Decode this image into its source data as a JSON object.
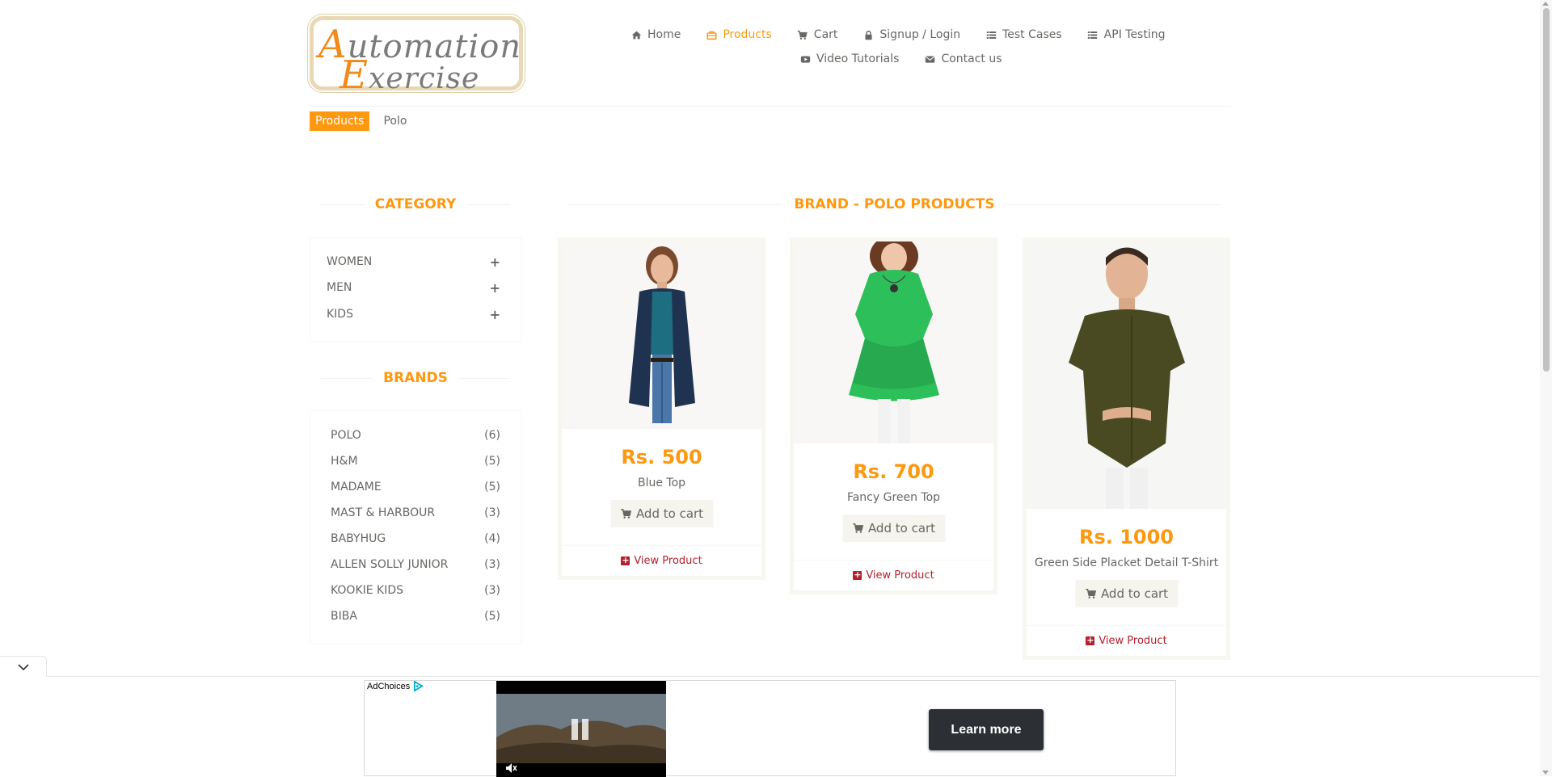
{
  "logo": {
    "line1_cap": "A",
    "line1_rest": "utomation",
    "line2_cap": "E",
    "line2_rest": "xercise"
  },
  "nav": {
    "row1": [
      {
        "label": "Home",
        "icon": "home-icon",
        "active": false
      },
      {
        "label": "Products",
        "icon": "shopping-bag-icon",
        "active": true
      },
      {
        "label": "Cart",
        "icon": "cart-icon",
        "active": false
      },
      {
        "label": "Signup / Login",
        "icon": "lock-icon",
        "active": false
      },
      {
        "label": "Test Cases",
        "icon": "list-icon",
        "active": false
      },
      {
        "label": "API Testing",
        "icon": "list-icon",
        "active": false
      }
    ],
    "row2": [
      {
        "label": "Video Tutorials",
        "icon": "youtube-icon",
        "active": false
      },
      {
        "label": "Contact us",
        "icon": "envelope-icon",
        "active": false
      }
    ]
  },
  "breadcrumb": {
    "section": "Products",
    "current": "Polo"
  },
  "sidebar": {
    "category_title": "Category",
    "categories": [
      {
        "label": "WOMEN"
      },
      {
        "label": "MEN"
      },
      {
        "label": "KIDS"
      }
    ],
    "brands_title": "Brands",
    "brands": [
      {
        "label": "POLO",
        "count": "(6)"
      },
      {
        "label": "H&M",
        "count": "(5)"
      },
      {
        "label": "MADAME",
        "count": "(5)"
      },
      {
        "label": "MAST & HARBOUR",
        "count": "(3)"
      },
      {
        "label": "BABYHUG",
        "count": "(4)"
      },
      {
        "label": "ALLEN SOLLY JUNIOR",
        "count": "(3)"
      },
      {
        "label": "KOOKIE KIDS",
        "count": "(3)"
      },
      {
        "label": "BIBA",
        "count": "(5)"
      }
    ]
  },
  "main": {
    "title": "Brand - Polo Products",
    "products": [
      {
        "price": "Rs. 500",
        "name": "Blue Top",
        "add_label": "Add to cart",
        "view_label": "View Product"
      },
      {
        "price": "Rs. 700",
        "name": "Fancy Green Top",
        "add_label": "Add to cart",
        "view_label": "View Product"
      },
      {
        "price": "Rs. 1000",
        "name": "Green Side Placket Detail T-Shirt",
        "add_label": "Add to cart",
        "view_label": "View Product"
      }
    ]
  },
  "ad": {
    "adchoices": "AdChoices",
    "cta": "Learn more"
  },
  "colors": {
    "accent": "#fe980f",
    "text": "#696763",
    "view_product": "#b4202b"
  }
}
